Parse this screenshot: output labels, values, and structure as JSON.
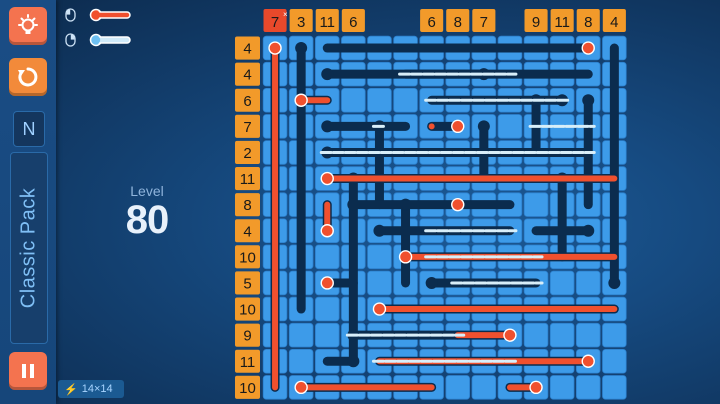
{
  "sidebar": {
    "hint_icon": "lightbulb-icon",
    "reset_icon": "restart-icon",
    "pause_icon": "pause-icon",
    "difficulty": "N",
    "pack": "Classic Pack"
  },
  "legend": {
    "fill_control": "mouse-left-click-icon",
    "empty_control": "mouse-right-click-icon"
  },
  "level": {
    "label": "Level",
    "number": "80"
  },
  "grid_size": "14×14",
  "colors": {
    "cell": "#3d9be9",
    "liquid": "#f0502e",
    "empty_tube": "#d8eef9",
    "hint_active": "#e8492b",
    "clue": "#f29a2a"
  },
  "board": {
    "rows": 14,
    "cols": 14,
    "column_clues": [
      "7",
      "3",
      "11",
      "6",
      "",
      "",
      "6",
      "8",
      "7",
      "",
      "9",
      "11",
      "8",
      "4"
    ],
    "row_clues": [
      "4",
      "4",
      "6",
      "7",
      "2",
      "11",
      "8",
      "4",
      "10",
      "5",
      "10",
      "9",
      "11",
      "10"
    ],
    "active_column_clue": 0
  }
}
